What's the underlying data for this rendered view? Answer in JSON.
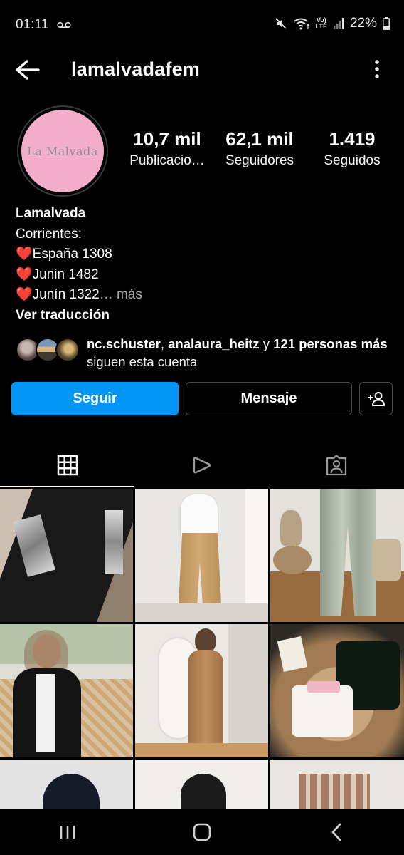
{
  "status_bar": {
    "time": "01:11",
    "battery": "22%",
    "network_label": "Vo) LTE",
    "icons": [
      "voicemail-icon",
      "mute-icon",
      "wifi-icon",
      "lte-icon",
      "signal-icon",
      "battery-icon"
    ]
  },
  "header": {
    "username": "lamalvadafem",
    "back_icon": "arrow-left-icon",
    "more_icon": "more-vertical-icon"
  },
  "profile": {
    "avatar_text": "La Malvada",
    "avatar_color": "#f3aec9",
    "stats": [
      {
        "value": "10,7 mil",
        "label": "Publicacio…"
      },
      {
        "value": "62,1 mil",
        "label": "Seguidores"
      },
      {
        "value": "1.419",
        "label": "Seguidos"
      }
    ]
  },
  "bio": {
    "name": "Lamalvada",
    "lines": [
      "Corrientes:",
      "España 1308",
      "Junin 1482",
      "Junín 1322"
    ],
    "heart": "❤️",
    "ellipsis": "…",
    "more": " más",
    "translate": "Ver traducción"
  },
  "followed_by": {
    "user1": "nc.schuster",
    "sep": ", ",
    "user2": "analaura_heitz",
    "and": " y ",
    "others": "121 personas más",
    "suffix": " siguen esta cuenta"
  },
  "actions": {
    "follow": "Seguir",
    "message": "Mensaje",
    "add_icon": "add-person-icon",
    "follow_color": "#0095f6"
  },
  "tabs": [
    {
      "icon": "grid-icon",
      "active": true
    },
    {
      "icon": "reels-icon",
      "active": false
    },
    {
      "icon": "tagged-icon",
      "active": false
    }
  ],
  "grid_posts_count_visible": 9,
  "nav": {
    "icons": [
      "recent-apps-icon",
      "home-icon",
      "back-icon"
    ]
  }
}
